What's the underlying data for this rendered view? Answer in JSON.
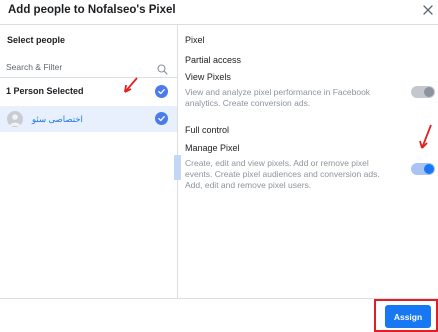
{
  "dialog": {
    "title": "Add people to Nofalseo's Pixel",
    "close_icon": "close-icon"
  },
  "left": {
    "select_label": "Select people",
    "search": {
      "placeholder": "Search & Filter",
      "value": "",
      "icon": "search-icon"
    },
    "selected_label": "1 Person Selected",
    "people": [
      {
        "name": "اختصاصی سئو",
        "selected": true
      }
    ]
  },
  "right": {
    "asset_title": "Pixel",
    "sections": [
      {
        "title": "Partial access",
        "permission": "View Pixels",
        "description": "View and analyze pixel performance in Facebook analytics. Create conversion ads.",
        "enabled": false
      },
      {
        "title": "Full control",
        "permission": "Manage Pixel",
        "description": "Create, edit and view pixels. Add or remove pixel events. Create pixel audiences and conversion ads. Add, edit and remove pixel users.",
        "enabled": true
      }
    ]
  },
  "footer": {
    "assign_label": "Assign"
  },
  "colors": {
    "primary": "#1877f2",
    "annotation": "#e02020",
    "selected_row": "#e7f0fc"
  }
}
